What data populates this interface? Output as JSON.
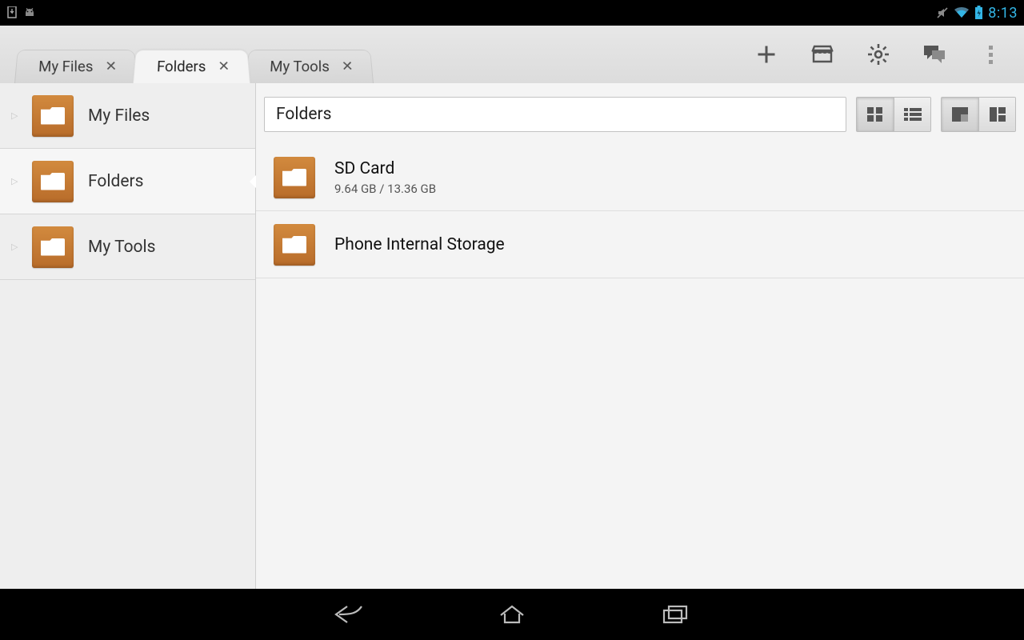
{
  "statusbar": {
    "time": "8:13"
  },
  "tabs": [
    {
      "label": "My Files",
      "active": false
    },
    {
      "label": "Folders",
      "active": true
    },
    {
      "label": "My Tools",
      "active": false
    }
  ],
  "sidebar": {
    "items": [
      {
        "label": "My Files"
      },
      {
        "label": "Folders"
      },
      {
        "label": "My Tools"
      }
    ],
    "selected_index": 1
  },
  "pane": {
    "breadcrumb": "Folders",
    "rows": [
      {
        "title": "SD Card",
        "subtitle": "9.64 GB / 13.36 GB"
      },
      {
        "title": "Phone Internal Storage",
        "subtitle": ""
      }
    ]
  }
}
